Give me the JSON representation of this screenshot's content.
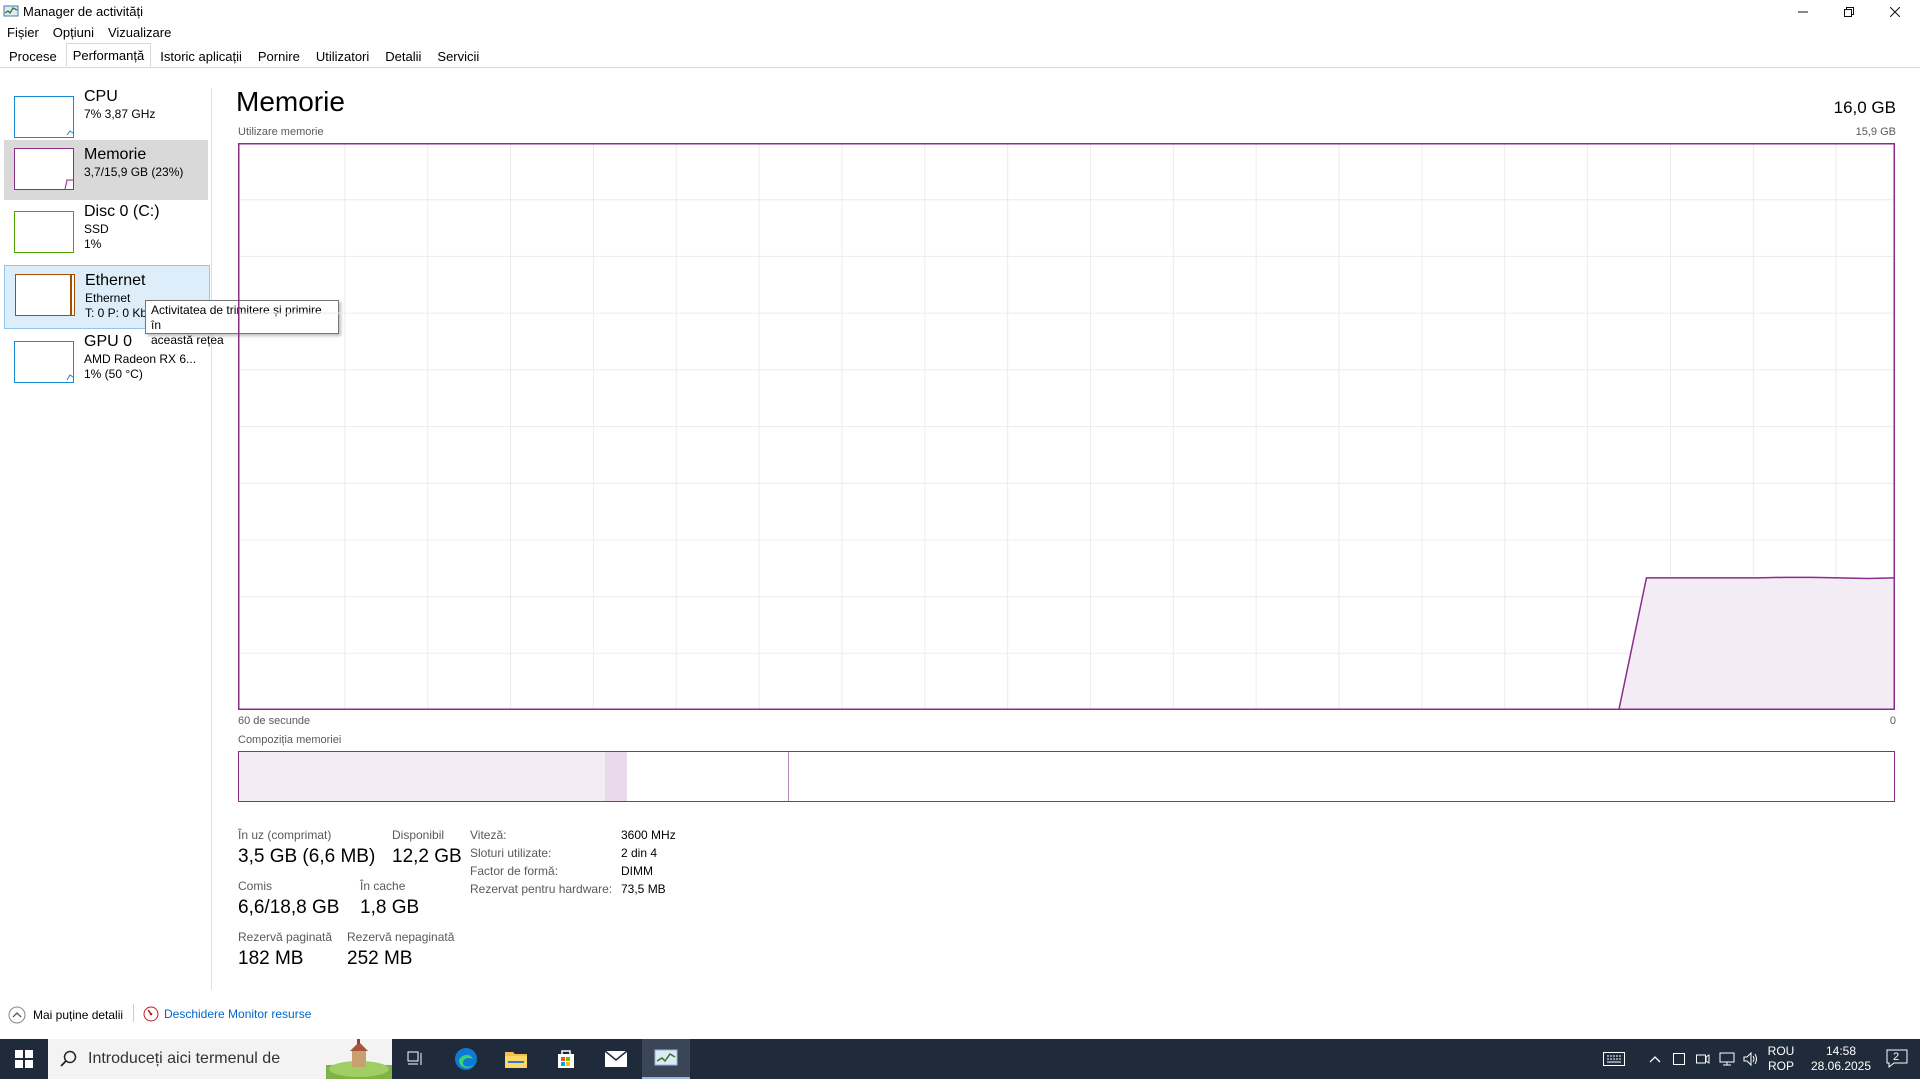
{
  "window": {
    "title": "Manager de activități",
    "controls": [
      "minimize-icon",
      "restore-icon",
      "close-icon"
    ]
  },
  "menu": {
    "items": [
      "Fișier",
      "Opțiuni",
      "Vizualizare"
    ]
  },
  "tabs": [
    {
      "label": "Procese",
      "active": false
    },
    {
      "label": "Performanță",
      "active": true
    },
    {
      "label": "Istoric aplicații",
      "active": false
    },
    {
      "label": "Pornire",
      "active": false
    },
    {
      "label": "Utilizatori",
      "active": false
    },
    {
      "label": "Detalii",
      "active": false
    },
    {
      "label": "Servicii",
      "active": false
    }
  ],
  "sidebar": {
    "items": [
      {
        "title": "CPU",
        "line1": "7% 3,87 GHz",
        "line2": "",
        "color": "#1a8ad4"
      },
      {
        "title": "Memorie",
        "line1": "3,7/15,9 GB (23%)",
        "line2": "",
        "color": "#8b2d8b"
      },
      {
        "title": "Disc 0 (C:)",
        "line1": "SSD",
        "line2": "1%",
        "color": "#4da600"
      },
      {
        "title": "Ethernet",
        "line1": "Ethernet",
        "line2": "T: 0 P: 0 Kb",
        "color": "#a74f01"
      },
      {
        "title": "GPU 0",
        "line1": "AMD Radeon RX 6...",
        "line2": "1% (50 °C)",
        "color": "#1a8ad4"
      }
    ]
  },
  "tooltip": {
    "line1": "Activitatea de trimitere și primire în",
    "line2": "această rețea"
  },
  "main": {
    "title": "Memorie",
    "total": "16,0 GB",
    "usage_label": "Utilizare memorie",
    "usage_max": "15,9 GB",
    "axis_left": "60 de secunde",
    "axis_right": "0",
    "composition_label": "Compoziția memoriei",
    "graph_color": "#8b2d8b",
    "graph_series": [
      0,
      0,
      0,
      0,
      0,
      0,
      0,
      0,
      0,
      0,
      0,
      0,
      0,
      0,
      0,
      0,
      0,
      0,
      0,
      0,
      0,
      0,
      0,
      0,
      0,
      0,
      0,
      0,
      0,
      0,
      0,
      0,
      0,
      0,
      0,
      0,
      0,
      0,
      0,
      0,
      0,
      0,
      0,
      0,
      0,
      0,
      0,
      0,
      0,
      0,
      0,
      0.233,
      0.233,
      0.233,
      0.233,
      0.233,
      0.234,
      0.234,
      0.233,
      0.232,
      0.233
    ],
    "composition": {
      "in_use": 0.221,
      "modified": 0.013,
      "standby": 0.097
    },
    "stats": {
      "in_use_label": "În uz (comprimat)",
      "in_use_value": "3,5 GB (6,6 MB)",
      "available_label": "Disponibil",
      "available_value": "12,2 GB",
      "committed_label": "Comis",
      "committed_value": "6,6/18,8 GB",
      "cached_label": "În cache",
      "cached_value": "1,8 GB",
      "paged_label": "Rezervă paginată",
      "paged_value": "182 MB",
      "nonpaged_label": "Rezervă nepaginată",
      "nonpaged_value": "252 MB"
    },
    "specs": [
      {
        "label": "Viteză:",
        "value": "3600 MHz"
      },
      {
        "label": "Sloturi utilizate:",
        "value": "2 din 4"
      },
      {
        "label": "Factor de formă:",
        "value": "DIMM"
      },
      {
        "label": "Rezervat pentru hardware:",
        "value": "73,5 MB"
      }
    ]
  },
  "footer": {
    "fewer_details": "Mai puține detalii",
    "open_monitor": "Deschidere Monitor resurse"
  },
  "taskbar": {
    "search_placeholder": "Introduceți aici termenul de",
    "lang_top": "ROU",
    "lang_bottom": "ROP",
    "time": "14:58",
    "date": "28.06.2025",
    "notifications": "2"
  }
}
